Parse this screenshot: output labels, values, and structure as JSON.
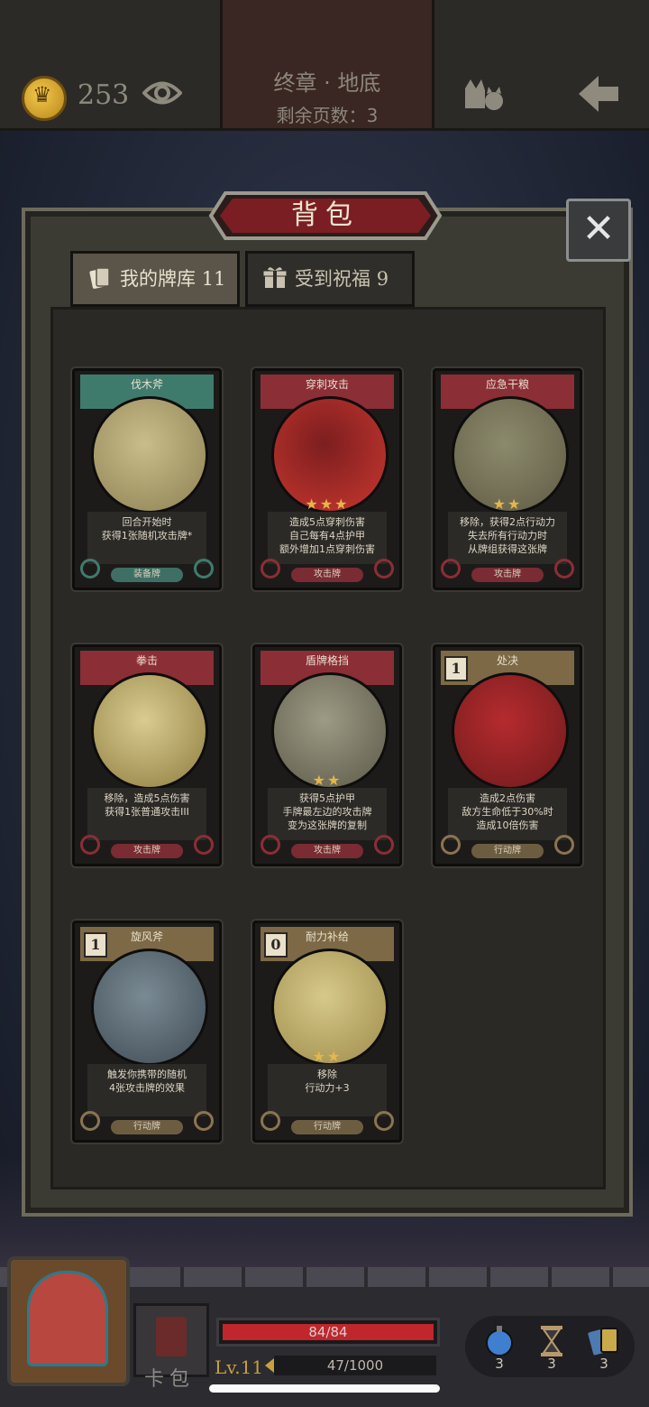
{
  "header": {
    "coins": "253",
    "chapter": "终章 · 地底",
    "pages_left": "剩余页数：3",
    "icons": [
      "coin-icon",
      "eye-icon",
      "cat-companions-icon",
      "back-arrow-icon"
    ]
  },
  "bag": {
    "title": "背包",
    "close_icon": "close-icon",
    "tabs": [
      {
        "label": "我的牌库",
        "count": "11",
        "icon": "cards-icon",
        "active": true
      },
      {
        "label": "受到祝福",
        "count": "9",
        "icon": "gift-icon",
        "active": false
      }
    ]
  },
  "cards": [
    {
      "name": "伐木斧",
      "color": "green",
      "stars": "",
      "desc1": "回合开始时",
      "desc2": "获得1张随机攻击牌*",
      "desc3": "",
      "type": "装备牌",
      "cost": ""
    },
    {
      "name": "穿刺攻击",
      "color": "red",
      "stars": "★★★",
      "desc1": "造成5点穿刺伤害",
      "desc2": "自己每有4点护甲",
      "desc3": "额外增加1点穿刺伤害",
      "type": "攻击牌",
      "cost": ""
    },
    {
      "name": "应急干粮",
      "color": "red",
      "stars": "★★",
      "desc1": "移除，获得2点行动力",
      "desc2": "失去所有行动力时",
      "desc3": "从牌组获得这张牌",
      "type": "攻击牌",
      "cost": ""
    },
    {
      "name": "拳击",
      "color": "red",
      "stars": "",
      "desc1": "移除，造成5点伤害",
      "desc2": "获得1张普通攻击III",
      "desc3": "",
      "type": "攻击牌",
      "cost": ""
    },
    {
      "name": "盾牌格挡",
      "color": "red",
      "stars": "★★",
      "desc1": "获得5点护甲",
      "desc2": "手牌最左边的攻击牌",
      "desc3": "变为这张牌的复制",
      "type": "攻击牌",
      "cost": ""
    },
    {
      "name": "处决",
      "color": "gold",
      "stars": "",
      "desc1": "造成2点伤害",
      "desc2": "敌方生命低于30%时",
      "desc3": "造成10倍伤害",
      "type": "行动牌",
      "cost": "1"
    },
    {
      "name": "旋风斧",
      "color": "gold",
      "stars": "",
      "desc1": "触发你携带的随机",
      "desc2": "4张攻击牌的效果",
      "desc3": "",
      "type": "行动牌",
      "cost": "1"
    },
    {
      "name": "耐力补给",
      "color": "gold",
      "stars": "★★",
      "desc1": "移除",
      "desc2": "行动力+3",
      "desc3": "",
      "type": "行动牌",
      "cost": "0"
    }
  ],
  "hud": {
    "deck_label": "卡包",
    "hp": "84/84",
    "hp_fraction": 1.0,
    "level": "Lv.11",
    "xp": "47/1000",
    "items": [
      {
        "icon": "bomb-potion-icon",
        "count": "3",
        "color": "#3f7fd0"
      },
      {
        "icon": "hourglass-icon",
        "count": "3",
        "color": "#b89a6a"
      },
      {
        "icon": "card-pack-icon",
        "count": "3",
        "color": "#4d7ab0"
      }
    ]
  }
}
